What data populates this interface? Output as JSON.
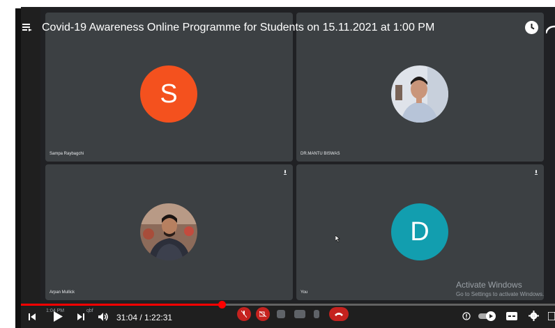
{
  "video": {
    "title": "Covid-19 Awareness Online Programme for Students on 15.11.2021 at 1:00 PM",
    "time_display": "31:04 / 1:22:31",
    "progress": 0.376
  },
  "meet": {
    "tiles": [
      {
        "name": "Sampa Raybagchi",
        "avatar": "S",
        "avatar_color": "#f4511e"
      },
      {
        "name": "DR.MANTU BISWAS",
        "avatar": "photo"
      },
      {
        "name": "Arpan Mullick",
        "avatar": "photo"
      },
      {
        "name": "You",
        "avatar": "D",
        "avatar_color": "#129eaf"
      }
    ],
    "overlay_time": "1:04 PM",
    "overlay_code": "qbf"
  },
  "watermark": {
    "line1": "Activate Windows",
    "line2": "Go to Settings to activate Windows."
  },
  "colors": {
    "accent": "#ff0000",
    "tile_bg": "#3c4043",
    "meet_red": "#c5221f"
  }
}
